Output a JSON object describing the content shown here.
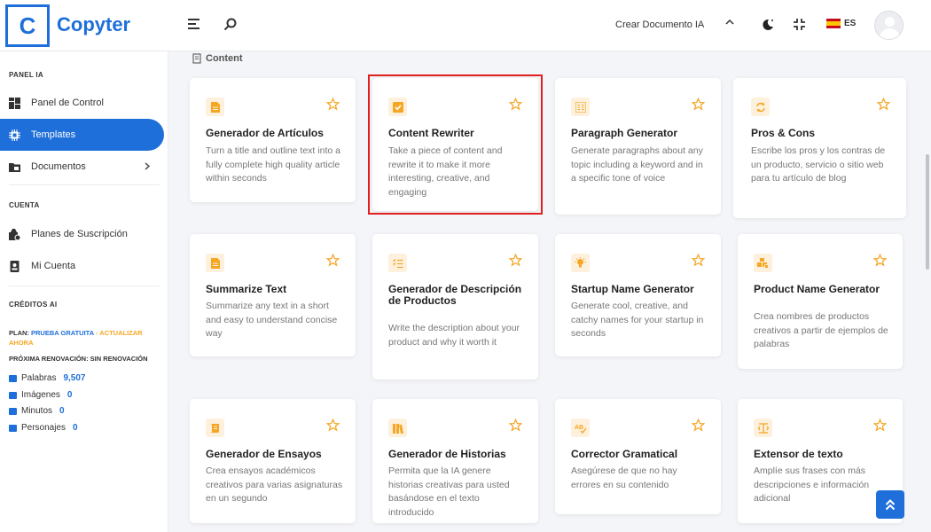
{
  "header": {
    "logo_letter": "C",
    "brand": "Copyter",
    "create_doc_label": "Crear Documento IA",
    "lang": "ES"
  },
  "sidebar": {
    "section_panel": "PANEL IA",
    "items": [
      {
        "label": "Panel de Control",
        "icon": "dashboard-icon"
      },
      {
        "label": "Templates",
        "icon": "chip-icon",
        "active": true
      },
      {
        "label": "Documentos",
        "icon": "folder-icon"
      }
    ],
    "section_account": "CUENTA",
    "account_items": [
      {
        "label": "Planes de Suscripción",
        "icon": "box-icon"
      },
      {
        "label": "Mi Cuenta",
        "icon": "id-badge-icon"
      }
    ],
    "section_credits": "CRÉDITOS AI",
    "plan_prefix": "PLAN:",
    "plan_name": "PRUEBA GRATUITA",
    "plan_sep": "-",
    "plan_upgrade": "ACTUALIZAR AHORA",
    "renewal": "PRÓXIMA RENOVACIÓN: SIN RENOVACIÓN",
    "credits": [
      {
        "label": "Palabras",
        "value": "9,507"
      },
      {
        "label": "Imágenes",
        "value": "0"
      },
      {
        "label": "Minutos",
        "value": "0"
      },
      {
        "label": "Personajes",
        "value": "0"
      }
    ]
  },
  "main": {
    "section_label": "Content",
    "cards": [
      {
        "title": "Generador de Artículos",
        "desc": "Turn a title and outline text into a fully complete high quality article within seconds",
        "icon": "document-icon"
      },
      {
        "title": "Content Rewriter",
        "desc": "Take a piece of content and rewrite it to make it more interesting, creative, and engaging",
        "icon": "check-square-icon"
      },
      {
        "title": "Paragraph Generator",
        "desc": "Generate paragraphs about any topic including a keyword and in a specific tone of voice",
        "icon": "paragraph-icon"
      },
      {
        "title": "Pros & Cons",
        "desc": "Escribe los pros y los contras de un producto, servicio o sitio web para tu artículo de blog",
        "icon": "sync-icon"
      },
      {
        "title": "Summarize Text",
        "desc": "Summarize any text in a short and easy to understand concise way",
        "icon": "document-icon"
      },
      {
        "title": "Generador de Descripción de Productos",
        "desc": "Write the description about your product and why it worth it",
        "icon": "list-check-icon"
      },
      {
        "title": "Startup Name Generator",
        "desc": "Generate cool, creative, and catchy names for your startup in seconds",
        "icon": "lightbulb-icon"
      },
      {
        "title": "Product Name Generator",
        "desc": "Crea nombres de productos creativos a partir de ejemplos de palabras",
        "icon": "boxes-icon"
      },
      {
        "title": "Generador de Ensayos",
        "desc": "Crea ensayos académicos creativos para varias asignaturas en un segundo",
        "icon": "scroll-icon"
      },
      {
        "title": "Generador de Historias",
        "desc": "Permita que la IA genere historias creativas para usted basándose en el texto introducido",
        "icon": "books-icon"
      },
      {
        "title": "Corrector Gramatical",
        "desc": "Asegúrese de que no hay errores en su contenido",
        "icon": "spell-check-icon"
      },
      {
        "title": "Extensor de texto",
        "desc": "Amplíe sus frases con más descripciones e información adicional",
        "icon": "expand-text-icon"
      }
    ]
  },
  "colors": {
    "brand": "#1e6fd9",
    "accent_orange": "#f5a623",
    "highlight_red": "#e01f1f"
  }
}
